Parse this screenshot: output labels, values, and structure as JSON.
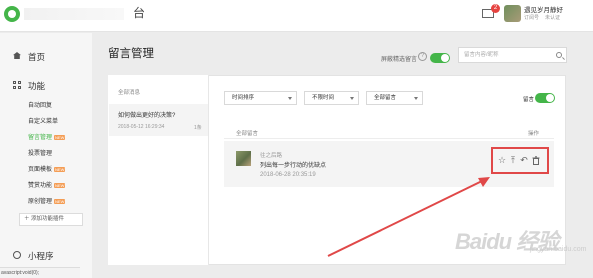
{
  "topbar": {
    "brand_suffix": "台",
    "mail_badge_count": "2",
    "account_name": "遇见岁月静好",
    "account_sub1": "订阅号",
    "account_sub2": "未认证"
  },
  "sidebar": {
    "home": "首页",
    "functions": "功能",
    "items": [
      {
        "label": "自动回复",
        "tag": ""
      },
      {
        "label": "自定义菜单",
        "tag": ""
      },
      {
        "label": "留言管理",
        "tag": "NEW",
        "active": true
      },
      {
        "label": "投票管理",
        "tag": ""
      },
      {
        "label": "页面模板",
        "tag": "NEW"
      },
      {
        "label": "赞赏功能",
        "tag": "NEW"
      },
      {
        "label": "原创管理",
        "tag": "NEW"
      }
    ],
    "add_plugin": "＋ 添加功能插件",
    "mini_program": "小程序"
  },
  "status_bar": "avascript:void(0);",
  "main": {
    "title": "留言管理",
    "hide_reviewed_label": "屏蔽精选留言",
    "help": "?",
    "search_placeholder": "留言内容/昵称"
  },
  "list": {
    "header": "全部消息",
    "items": [
      {
        "title": "如何做出更好的决策?",
        "date": "2018-05-12 16:29:34",
        "count": "1条"
      }
    ]
  },
  "filters": {
    "sort": "时间排序",
    "time": "不限时间",
    "type": "全部留言",
    "message_toggle_label": "留言"
  },
  "table": {
    "header_all": "全部留言",
    "header_ops": "操作",
    "rows": [
      {
        "name": "往之后路",
        "text": "列出每一步行动的优缺点",
        "time": "2018-06-28 20:35:19"
      }
    ]
  },
  "watermark": {
    "text": "Baidu 经验",
    "sub": "jingyan.baidu.com"
  },
  "colors": {
    "accent": "#44b549",
    "highlight": "#e04848"
  }
}
